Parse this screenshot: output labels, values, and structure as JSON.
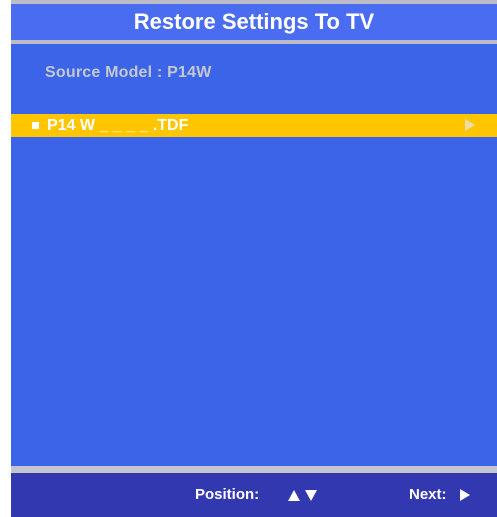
{
  "title": "Restore Settings To TV",
  "source_model": "Source Model : P14W",
  "file_list": {
    "items": [
      {
        "label": "P14 W _ _ _ _ .TDF",
        "selected": true
      }
    ]
  },
  "footer": {
    "position_label": "Position:",
    "next_label": "Next:"
  },
  "icons": {
    "up": "up-arrow-icon",
    "down": "down-arrow-icon",
    "next": "right-arrow-icon",
    "bullet": "square-bullet-icon"
  },
  "colors": {
    "panel_bg": "#3b64e8",
    "title_bg": "#4a6cf0",
    "highlight": "#ffc600",
    "footer_bg": "#3238b0",
    "border": "#c5c5d2",
    "muted_text": "#c6c8d0"
  }
}
